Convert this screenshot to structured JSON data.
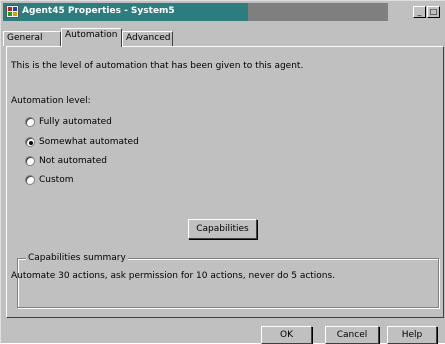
{
  "window": {
    "title": "Agent45 Properties - System5",
    "icon": "java-cup-icon",
    "controls": {
      "minimize": "_",
      "maximize": "□"
    }
  },
  "tabs": [
    {
      "label": "General",
      "active": false
    },
    {
      "label": "Automation",
      "active": true
    },
    {
      "label": "Advanced",
      "active": false
    }
  ],
  "automation": {
    "description": "This is the level of automation that has been given to this agent.",
    "level_label": "Automation level:",
    "options": [
      {
        "label": "Fully automated",
        "selected": false
      },
      {
        "label": "Somewhat automated",
        "selected": true
      },
      {
        "label": "Not automated",
        "selected": false
      },
      {
        "label": "Custom",
        "selected": false
      }
    ],
    "capabilities_button": "Capabilities"
  },
  "summary": {
    "title": "Capabilities summary",
    "text": "Automate 30 actions, ask permission for 10 actions, never do 5 actions."
  },
  "footer": {
    "ok": "OK",
    "cancel": "Cancel",
    "help": "Help"
  },
  "colors": {
    "titlebar_active": "#2c7d7d",
    "titlebar_inactive": "#7f7f7f",
    "face": "#c0c0c0"
  }
}
